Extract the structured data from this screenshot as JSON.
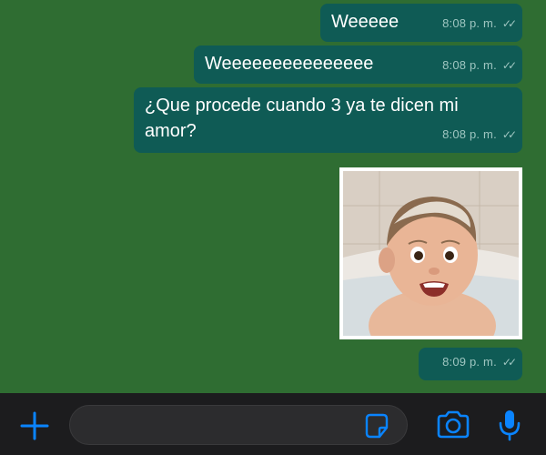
{
  "messages": [
    {
      "text": "Weeeee",
      "time": "8:08 p. m.",
      "status_ticks": "✓✓"
    },
    {
      "text": "Weeeeeeeeeeeeeee",
      "time": "8:08 p. m.",
      "status_ticks": "✓✓"
    },
    {
      "text": "¿Que procede cuando 3 ya te dicen mi amor?",
      "time": "8:08 p. m.",
      "status_ticks": "✓✓"
    },
    {
      "type": "image",
      "description_icon": "photo-baby-in-bath"
    },
    {
      "text": "",
      "time": "8:09 p. m.",
      "status_ticks": "✓✓"
    }
  ],
  "composer": {
    "placeholder": "",
    "icons": [
      "plus-icon",
      "sticker-icon",
      "camera-icon",
      "microphone-icon"
    ]
  },
  "colors": {
    "chat_background": "#2f6d32",
    "bubble": "#0f5b55",
    "bottom_bar": "#1c1c1e",
    "accent_icons": "#0a84ff"
  }
}
